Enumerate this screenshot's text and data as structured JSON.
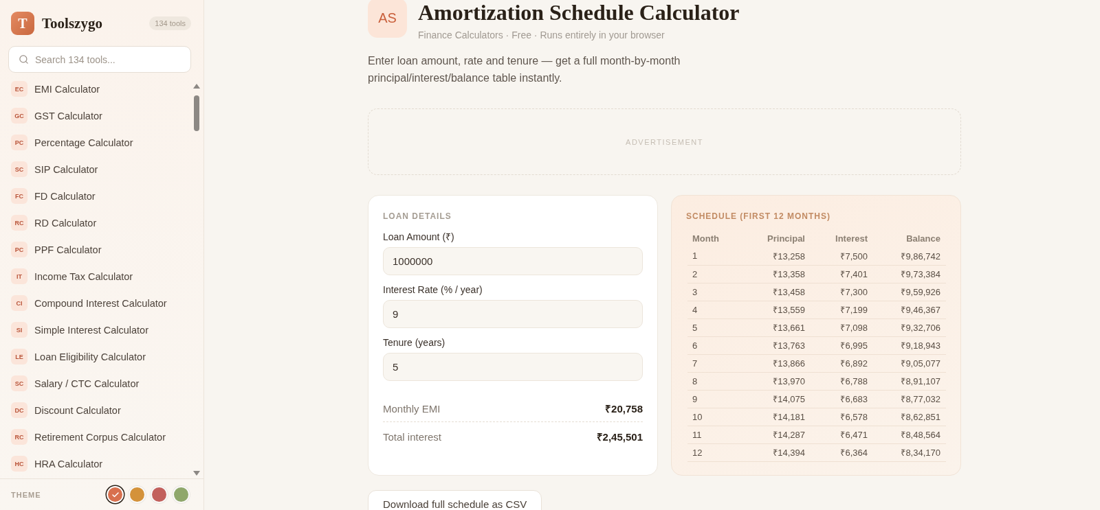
{
  "sidebar": {
    "brand": {
      "logo_letter": "T",
      "name": "Toolszygo",
      "badge": "134 tools"
    },
    "search": {
      "placeholder": "Search 134 tools..."
    },
    "items": [
      {
        "abbr": "EC",
        "label": "EMI Calculator"
      },
      {
        "abbr": "GC",
        "label": "GST Calculator"
      },
      {
        "abbr": "PC",
        "label": "Percentage Calculator"
      },
      {
        "abbr": "SC",
        "label": "SIP Calculator"
      },
      {
        "abbr": "FC",
        "label": "FD Calculator"
      },
      {
        "abbr": "RC",
        "label": "RD Calculator"
      },
      {
        "abbr": "PC",
        "label": "PPF Calculator"
      },
      {
        "abbr": "IT",
        "label": "Income Tax Calculator"
      },
      {
        "abbr": "CI",
        "label": "Compound Interest Calculator"
      },
      {
        "abbr": "SI",
        "label": "Simple Interest Calculator"
      },
      {
        "abbr": "LE",
        "label": "Loan Eligibility Calculator"
      },
      {
        "abbr": "SC",
        "label": "Salary / CTC Calculator"
      },
      {
        "abbr": "DC",
        "label": "Discount Calculator"
      },
      {
        "abbr": "RC",
        "label": "Retirement Corpus Calculator"
      },
      {
        "abbr": "HC",
        "label": "HRA Calculator"
      }
    ],
    "theme": {
      "label": "THEME",
      "swatches": [
        {
          "color": "#d8704e",
          "selected": true
        },
        {
          "color": "#d4923a",
          "selected": false
        },
        {
          "color": "#c2605c",
          "selected": false
        },
        {
          "color": "#8fa76b",
          "selected": false
        }
      ]
    }
  },
  "header": {
    "icon_text": "AS",
    "title": "Amortization Schedule Calculator",
    "subtitle": "Finance Calculators · Free · Runs entirely in your browser",
    "description": "Enter loan amount, rate and tenure — get a full month-by-month principal/interest/balance table instantly."
  },
  "ad": {
    "label": "ADVERTISEMENT"
  },
  "loan_details": {
    "heading": "LOAN DETAILS",
    "fields": [
      {
        "label": "Loan Amount (₹)",
        "value": "1000000"
      },
      {
        "label": "Interest Rate (% / year)",
        "value": "9"
      },
      {
        "label": "Tenure (years)",
        "value": "5"
      }
    ],
    "results": [
      {
        "label": "Monthly EMI",
        "value": "₹20,758"
      },
      {
        "label": "Total interest",
        "value": "₹2,45,501"
      }
    ]
  },
  "schedule": {
    "heading": "SCHEDULE (FIRST 12 MONTHS)",
    "columns": [
      "Month",
      "Principal",
      "Interest",
      "Balance"
    ],
    "rows": [
      [
        "1",
        "₹13,258",
        "₹7,500",
        "₹9,86,742"
      ],
      [
        "2",
        "₹13,358",
        "₹7,401",
        "₹9,73,384"
      ],
      [
        "3",
        "₹13,458",
        "₹7,300",
        "₹9,59,926"
      ],
      [
        "4",
        "₹13,559",
        "₹7,199",
        "₹9,46,367"
      ],
      [
        "5",
        "₹13,661",
        "₹7,098",
        "₹9,32,706"
      ],
      [
        "6",
        "₹13,763",
        "₹6,995",
        "₹9,18,943"
      ],
      [
        "7",
        "₹13,866",
        "₹6,892",
        "₹9,05,077"
      ],
      [
        "8",
        "₹13,970",
        "₹6,788",
        "₹8,91,107"
      ],
      [
        "9",
        "₹14,075",
        "₹6,683",
        "₹8,77,032"
      ],
      [
        "10",
        "₹14,181",
        "₹6,578",
        "₹8,62,851"
      ],
      [
        "11",
        "₹14,287",
        "₹6,471",
        "₹8,48,564"
      ],
      [
        "12",
        "₹14,394",
        "₹6,364",
        "₹8,34,170"
      ]
    ]
  },
  "download_button": "Download full schedule as CSV"
}
